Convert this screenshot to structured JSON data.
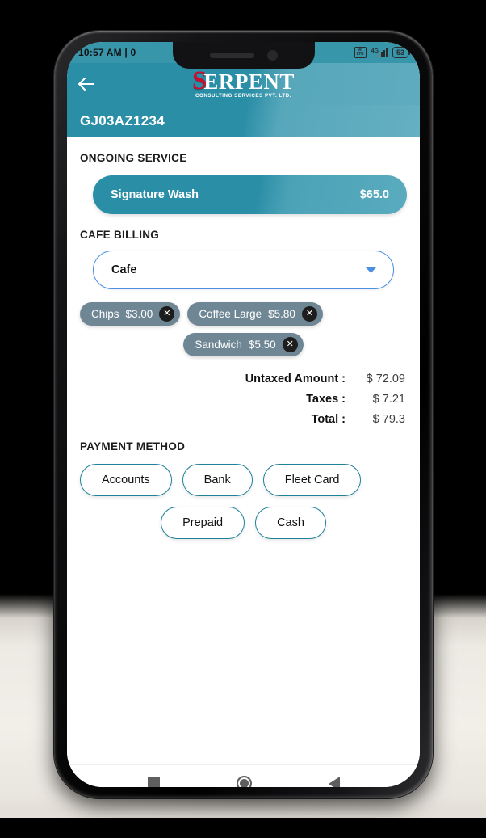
{
  "status_bar": {
    "time": "10:57 AM | 0",
    "volte_label": "VoLTE",
    "network": "4G",
    "battery": "53"
  },
  "app_bar": {
    "back_icon": "back-arrow-icon",
    "logo_initial": "S",
    "logo_name": "ERPENT",
    "logo_tagline": "CONSULTING SERVICES PVT. LTD."
  },
  "plate": {
    "number": "GJ03AZ1234"
  },
  "ongoing_service": {
    "heading": "ONGOING SERVICE",
    "name": "Signature Wash",
    "price": "$65.0"
  },
  "cafe_billing": {
    "heading": "CAFE BILLING",
    "selected": "Cafe",
    "chevron_icon": "chevron-down-icon",
    "items": [
      {
        "name": "Chips",
        "price": "$3.00"
      },
      {
        "name": "Coffee Large",
        "price": "$5.80"
      },
      {
        "name": "Sandwich",
        "price": "$5.50"
      }
    ],
    "remove_icon": "close-icon"
  },
  "totals": [
    {
      "label": "Untaxed Amount",
      "colon": ":",
      "value": "$ 72.09"
    },
    {
      "label": "Taxes",
      "colon": ":",
      "value": "$ 7.21"
    },
    {
      "label": "Total",
      "colon": ":",
      "value": "$ 79.3"
    }
  ],
  "payment_method": {
    "heading": "PAYMENT METHOD",
    "row1": [
      "Accounts",
      "Bank",
      "Fleet Card"
    ],
    "row2": [
      "Prepaid",
      "Cash"
    ]
  },
  "nav_bar": {
    "recents_icon": "square-recents-icon",
    "home_icon": "circle-home-icon",
    "back_icon": "triangle-back-icon"
  },
  "colors": {
    "teal": "#2a8ea6",
    "teal_light": "#5fabbe",
    "chip": "#6f8795",
    "dropdown_border": "#4a90e2",
    "button_border": "#1d8299",
    "logo_red": "#c8102e"
  }
}
